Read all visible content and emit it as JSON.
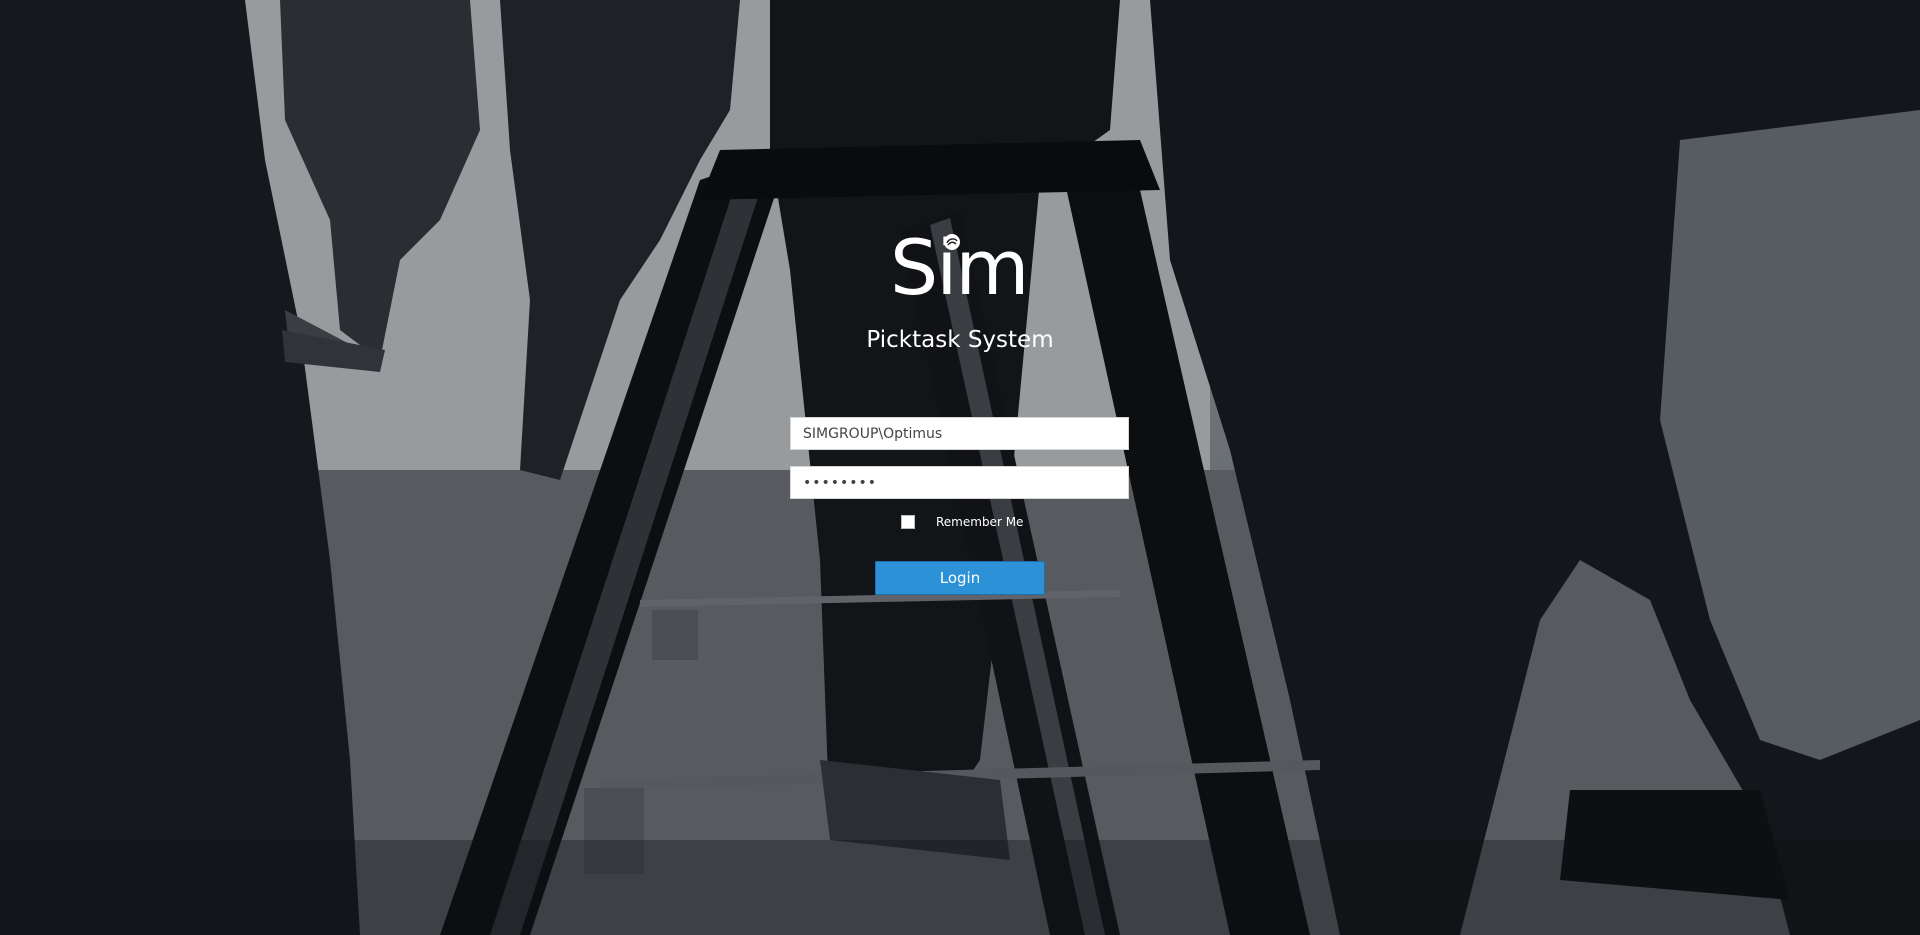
{
  "branding": {
    "logo_text": "Sim",
    "app_title": "Picktask System"
  },
  "form": {
    "username_value": "SIMGROUP\\Optimus",
    "password_value": "••••••••",
    "remember_label": "Remember Me",
    "remember_checked": false,
    "login_label": "Login"
  },
  "colors": {
    "button": "#2d91d8",
    "text": "#ffffff",
    "field_bg": "#ffffff"
  }
}
